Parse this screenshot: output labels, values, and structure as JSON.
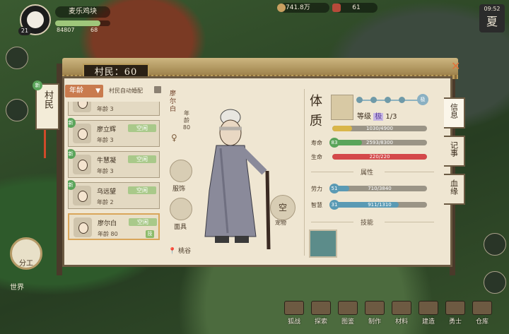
{
  "hud": {
    "player_name": "麦乐鸡块",
    "level": "21",
    "gems": "84807",
    "sprouts": "68",
    "progress": 0.82,
    "coins": "741.8万",
    "resource": "61",
    "time": "09:52",
    "season": "夏"
  },
  "left_buttons": {
    "dispatch": "分工",
    "world": "世界"
  },
  "bottom_bar": [
    {
      "label": "狐战"
    },
    {
      "label": "探索"
    },
    {
      "label": "图鉴"
    },
    {
      "label": "制作"
    },
    {
      "label": "材料"
    },
    {
      "label": "建造"
    },
    {
      "label": "勇士"
    },
    {
      "label": "仓库"
    }
  ],
  "panel": {
    "title": "村民：60",
    "lamp_label": "村民",
    "new_badge": "新",
    "sort_label": "年龄",
    "auto_match": "村民自动婚配",
    "residents": [
      {
        "name": "",
        "age": "年龄 3",
        "status": "",
        "new": false,
        "tag": ""
      },
      {
        "name": "廖立辉",
        "age": "年龄 3",
        "status": "空闲",
        "new": true,
        "tag": ""
      },
      {
        "name": "牛慧凝",
        "age": "年龄 3",
        "status": "空闲",
        "new": true,
        "tag": ""
      },
      {
        "name": "乌远望",
        "age": "年龄 2",
        "status": "空闲",
        "new": true,
        "tag": ""
      },
      {
        "name": "廖尔白",
        "age": "年龄 80",
        "status": "空闲",
        "new": false,
        "tag": "技",
        "selected": true
      }
    ],
    "detail": {
      "name": "廖尔白",
      "age_label": "年龄",
      "age": "80",
      "gender_icon": "female-symbol",
      "clothing_label": "服饰",
      "mask_label": "面具",
      "empty_slot": "空",
      "empty_label": "宠物",
      "location": "桃谷"
    },
    "stats": {
      "section_title": "体质",
      "tier_label": "等级",
      "tier_grade": "极",
      "tier_value": "1/3",
      "tier_end": "极",
      "bars": [
        {
          "label": "",
          "text": "1030/4900",
          "value": 0.21,
          "color": "#d9b64a",
          "badge": ""
        },
        {
          "label": "寿命",
          "text": "2593/8300",
          "value": 0.31,
          "color": "#5aa45a",
          "badge": "83",
          "badge_color": "#5aa45a"
        },
        {
          "label": "生命",
          "text": "220/220",
          "value": 1.0,
          "color": "#d4484a",
          "badge": ""
        }
      ],
      "attributes_head": "属性",
      "attrs": [
        {
          "label": "劳力",
          "text": "710/3840",
          "value": 0.18,
          "color": "#5a9ab4",
          "badge": "51"
        },
        {
          "label": "智慧",
          "text": "911/1310",
          "value": 0.7,
          "color": "#5a9ab4",
          "badge": "31"
        }
      ],
      "skills_head": "技能"
    },
    "tabs": [
      {
        "label": "信息",
        "active": true
      },
      {
        "label": "记事",
        "active": false
      },
      {
        "label": "血缘",
        "active": false
      }
    ]
  },
  "colors": {
    "accent": "#c97b4e",
    "panel": "#efe6d2",
    "frame": "#6b5a42"
  }
}
